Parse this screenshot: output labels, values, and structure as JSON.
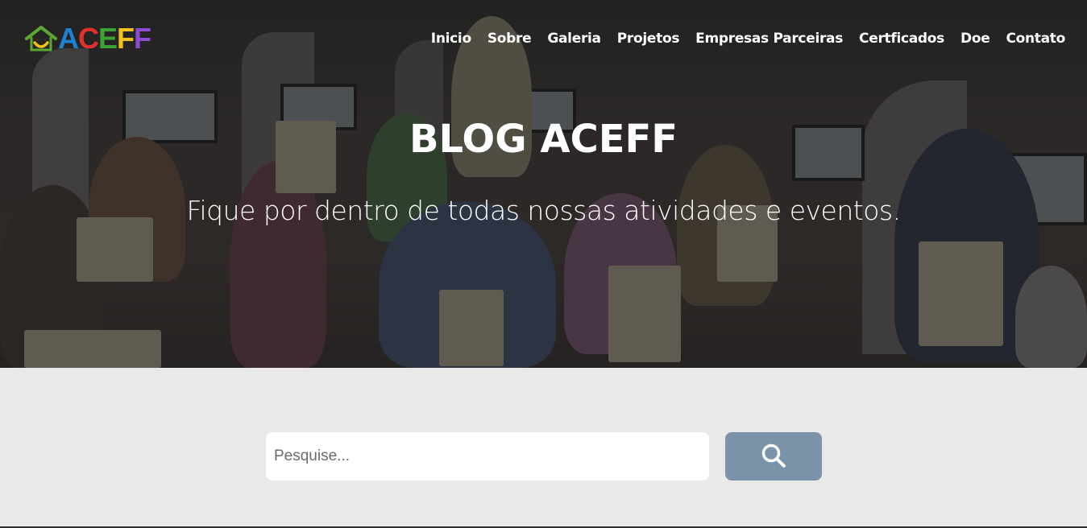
{
  "brand": {
    "logo_letters": [
      "A",
      "C",
      "E",
      "F",
      "F"
    ],
    "logo_colors": [
      "#1f7fd1",
      "#e0312c",
      "#3da234",
      "#f2c316",
      "#8d4bd6"
    ],
    "house_color": "#5aa830",
    "smile_color": "#f2c316"
  },
  "nav": {
    "items": [
      "Inicio",
      "Sobre",
      "Galeria",
      "Projetos",
      "Empresas Parceiras",
      "Certficados",
      "Doe",
      "Contato"
    ]
  },
  "hero": {
    "title": "BLOG ACEFF",
    "subtitle": "Fique por dentro de todas nossas atividades e eventos."
  },
  "search": {
    "placeholder": "Pesquise...",
    "value": "",
    "button_icon": "search-icon",
    "button_color": "#7a93a9"
  }
}
